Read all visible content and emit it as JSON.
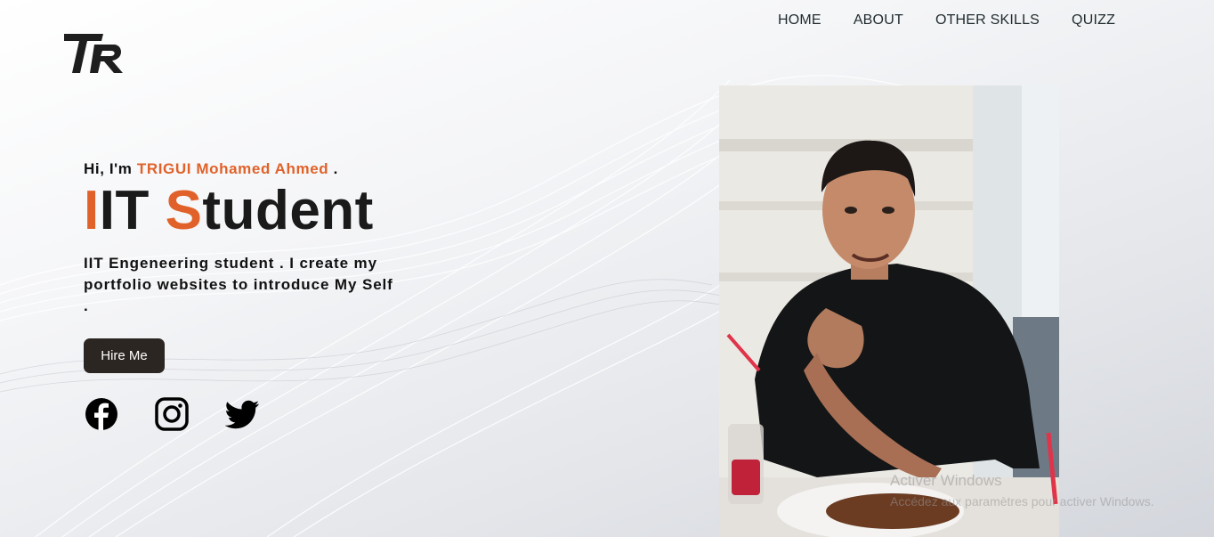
{
  "logo": {
    "text": "TR"
  },
  "nav": {
    "home": "HOME",
    "about": "ABOUT",
    "other_skills": "OTHER SKILLS",
    "quizz": "QUIZZ"
  },
  "hero": {
    "greeting_prefix": "Hi, I'm ",
    "name": "TRIGUI Mohamed Ahmed",
    "greeting_suffix": " .",
    "title_acc1": "I",
    "title_part1": "IT ",
    "title_acc2": "S",
    "title_part2": "tudent",
    "description": "IIT Engeneering student . I create my portfolio websites to introduce My Self .",
    "hire_button": "Hire Me"
  },
  "social": [
    "facebook-icon",
    "instagram-icon",
    "twitter-icon"
  ],
  "watermark": {
    "line1": "Activer Windows",
    "line2": "Accédez aux paramètres pour activer Windows."
  },
  "colors": {
    "accent": "#e0622a",
    "button": "#2b2622",
    "text": "#111111"
  }
}
